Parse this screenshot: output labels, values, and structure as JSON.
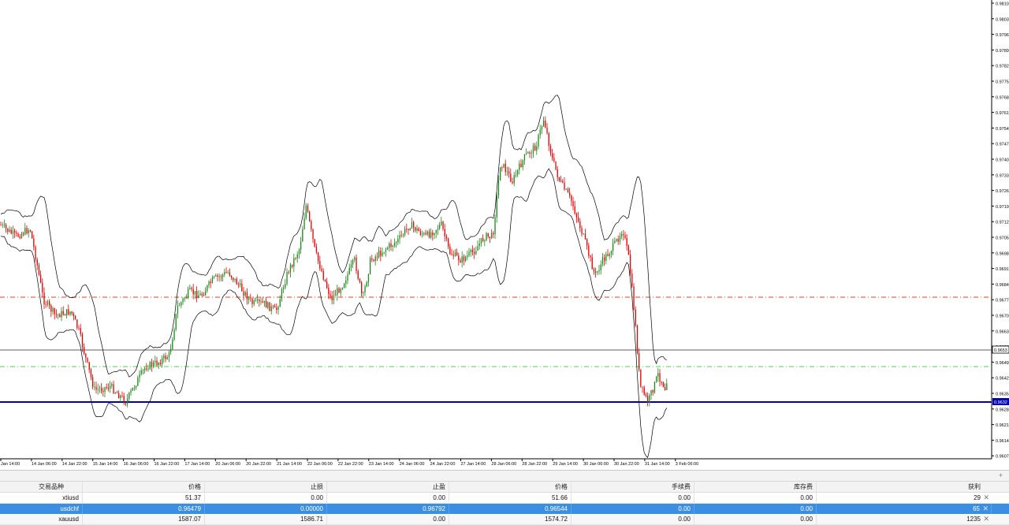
{
  "chart": {
    "price_axis_labels": [
      "0.9810",
      "0.9803",
      "0.9796",
      "0.9789",
      "0.9782",
      "0.9775",
      "0.9768",
      "0.9761",
      "0.9754",
      "0.9747",
      "0.9740",
      "0.9733",
      "0.9726",
      "0.9719",
      "0.9712",
      "0.9705",
      "0.9698",
      "0.9691",
      "0.9684",
      "0.9677",
      "0.9670",
      "0.9663",
      "0.9656",
      "0.9649",
      "0.9642",
      "0.9635",
      "0.9628",
      "0.9621",
      "0.9614",
      "0.9607"
    ],
    "time_axis_labels": [
      "Jan 14:00",
      "14 Jan 06:00",
      "14 Jan 22:00",
      "15 Jan 14:00",
      "16 Jan 06:00",
      "16 Jan 22:00",
      "17 Jan 14:00",
      "20 Jan 06:00",
      "20 Jan 22:00",
      "21 Jan 14:00",
      "22 Jan 06:00",
      "22 Jan 22:00",
      "23 Jan 14:00",
      "24 Jan 06:00",
      "24 Jan 22:00",
      "27 Jan 14:00",
      "28 Jan 06:00",
      "28 Jan 22:00",
      "29 Jan 14:00",
      "30 Jan 06:00",
      "30 Jan 22:00",
      "31 Jan 14:00",
      "3 Feb 06:00"
    ],
    "current_price_tag": "0.9653",
    "stop_price_tag": "0.9632",
    "colors": {
      "bull": "#1a8a1a",
      "bear": "#e60000",
      "bands": "#000000",
      "take_profit_line": "#e04020",
      "entry_line": "#55cc55",
      "stop_line": "#0000b0",
      "bid_line": "#606060"
    }
  },
  "terminal": {
    "headers": {
      "symbol": "交易品种",
      "price": "价格",
      "sl": "止损",
      "tp": "止盈",
      "current": "价格",
      "commission": "手续费",
      "swap": "库存费",
      "profit": "获利"
    },
    "rows": [
      {
        "symbol": "xtiusd",
        "price": "51.37",
        "sl": "0.00",
        "tp": "0.00",
        "current": "51.66",
        "commission": "0.00",
        "swap": "0.00",
        "profit": "29",
        "close": "✕"
      },
      {
        "symbol": "usdchf",
        "price": "0.96479",
        "sl": "0.00000",
        "tp": "0.96792",
        "current": "0.96544",
        "commission": "0.00",
        "swap": "0.00",
        "profit": "65",
        "close": "✕"
      },
      {
        "symbol": "xauusd",
        "price": "1587.07",
        "sl": "1586.71",
        "tp": "0.00",
        "current": "1574.72",
        "commission": "0.00",
        "swap": "0.00",
        "profit": "1235",
        "close": "✕"
      }
    ],
    "splitter_icon": "+"
  }
}
